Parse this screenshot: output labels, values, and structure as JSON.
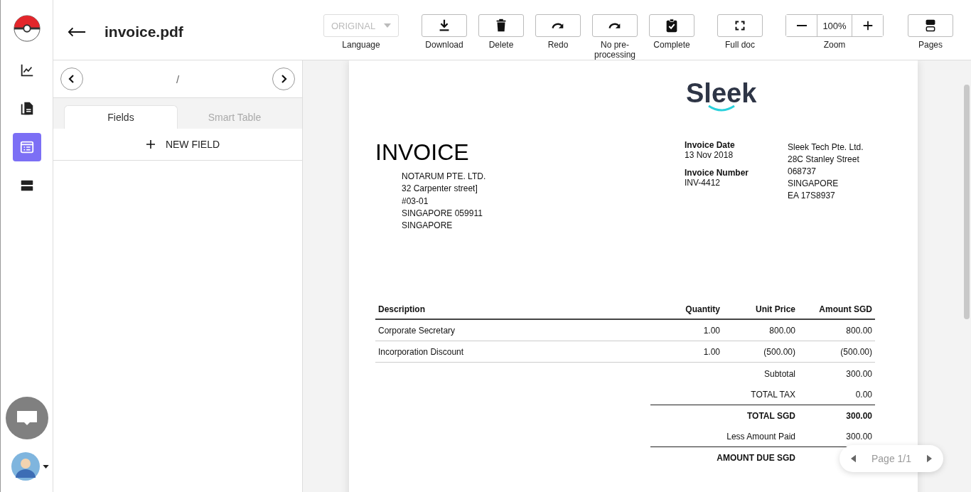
{
  "rail": {
    "items": [
      {
        "kind": "chart",
        "selected": false
      },
      {
        "kind": "documents",
        "selected": false
      },
      {
        "kind": "form",
        "selected": true
      },
      {
        "kind": "pages",
        "selected": false
      }
    ]
  },
  "header": {
    "title": "invoice.pdf",
    "language": {
      "value": "ORIGINAL",
      "label": "Language",
      "disabled": true
    },
    "tools": [
      {
        "kind": "download",
        "label": "Download"
      },
      {
        "kind": "delete",
        "label": "Delete"
      },
      {
        "kind": "redo",
        "label": "Redo"
      },
      {
        "kind": "redo",
        "label": "No pre-processing"
      },
      {
        "kind": "complete",
        "label": "Complete"
      },
      {
        "kind": "fullscreen",
        "label": "Full doc"
      }
    ],
    "zoom": {
      "value": "100%",
      "label": "Zoom"
    },
    "pages": {
      "label": "Pages"
    }
  },
  "panel": {
    "pager": "/",
    "tabs": [
      {
        "label": "Fields",
        "selected": true
      },
      {
        "label": "Smart Table",
        "selected": false
      }
    ],
    "new_field": "NEW FIELD"
  },
  "document": {
    "logo": "Sleek",
    "title": "INVOICE",
    "bill_to": [
      "NOTARUM PTE. LTD.",
      "32 Carpenter street]",
      "#03-01",
      "SINGAPORE 059911",
      "SINGAPORE"
    ],
    "details": [
      {
        "label": "Invoice Date",
        "value": "13 Nov 2018"
      },
      {
        "label": "Invoice Number",
        "value": "INV-4412"
      }
    ],
    "sender": [
      "Sleek Tech Pte. Ltd.",
      "28C Stanley Street",
      "068737",
      "SINGAPORE",
      "EA 17S8937"
    ],
    "table": {
      "columns": [
        "Description",
        "Quantity",
        "Unit Price",
        "Amount SGD"
      ],
      "rows": [
        [
          "Corporate Secretary",
          "1.00",
          "800.00",
          "800.00"
        ],
        [
          "Incorporation Discount",
          "1.00",
          "(500.00)",
          "(500.00)"
        ]
      ]
    },
    "totals": [
      {
        "label": "Subtotal",
        "value": "300.00",
        "bold": false,
        "rule_above": false
      },
      {
        "label": "TOTAL TAX",
        "value": "0.00",
        "bold": false,
        "rule_above": false
      },
      {
        "label": "TOTAL SGD",
        "value": "300.00",
        "bold": true,
        "rule_above": true
      },
      {
        "label": "Less Amount Paid",
        "value": "300.00",
        "bold": false,
        "rule_above": false
      },
      {
        "label": "AMOUNT DUE SGD",
        "bold": true,
        "rule_above": true
      }
    ]
  },
  "page_nav": {
    "label": "Page 1/1"
  }
}
